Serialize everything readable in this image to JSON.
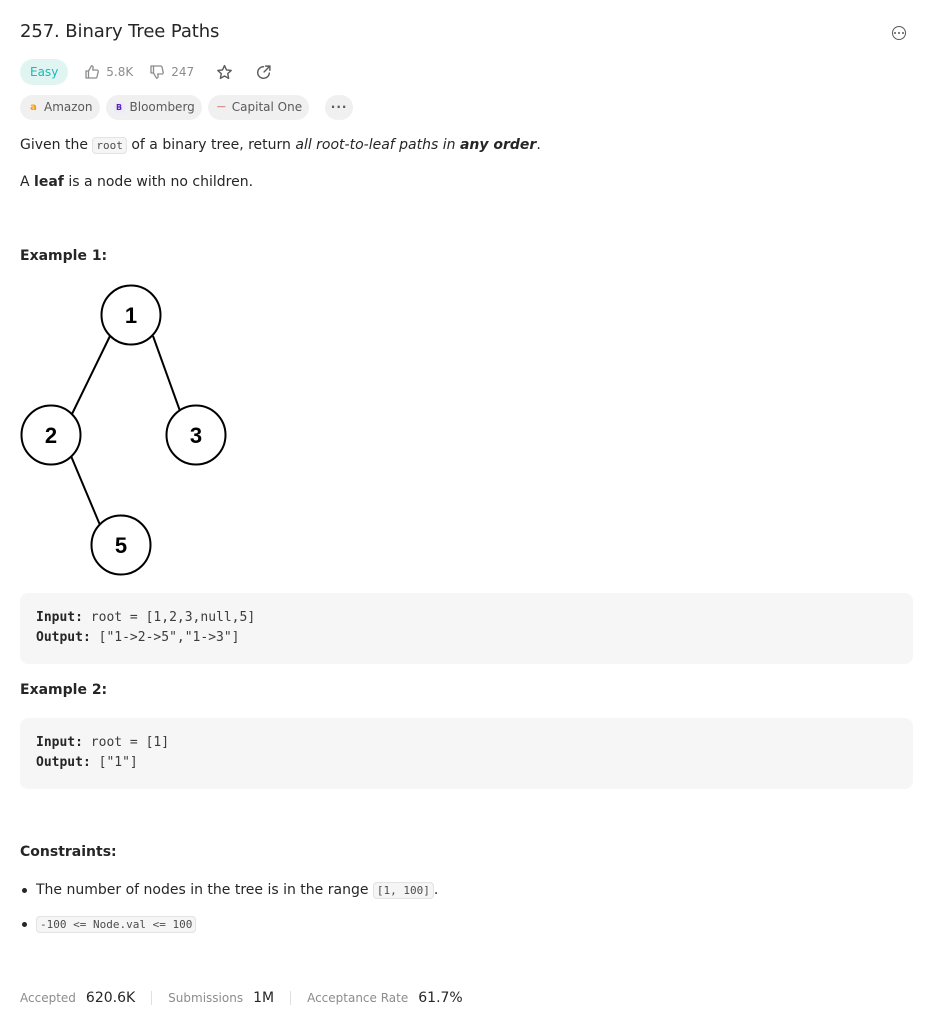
{
  "problem": {
    "title": "257. Binary Tree Paths",
    "difficulty": "Easy",
    "likes": "5.8K",
    "dislikes": "247"
  },
  "companies": [
    {
      "name": "Amazon",
      "logo": "a"
    },
    {
      "name": "Bloomberg",
      "logo": "B"
    },
    {
      "name": "Capital One",
      "logo": "—"
    }
  ],
  "more_tags": "···",
  "description": {
    "p1_pre": "Given the ",
    "p1_code": "root",
    "p1_mid": " of a binary tree, return ",
    "p1_italic": "all root-to-leaf paths in ",
    "p1_bold": "any order",
    "p1_end": ".",
    "p2_pre": "A ",
    "p2_bold": "leaf",
    "p2_end": " is a node with no children."
  },
  "example1": {
    "heading": "Example 1:",
    "tree_nodes": [
      "1",
      "2",
      "3",
      "5"
    ],
    "input_label": "Input:",
    "input_value": "root = [1,2,3,null,5]",
    "output_label": "Output:",
    "output_value": "[\"1->2->5\",\"1->3\"]"
  },
  "example2": {
    "heading": "Example 2:",
    "input_label": "Input:",
    "input_value": "root = [1]",
    "output_label": "Output:",
    "output_value": "[\"1\"]"
  },
  "constraints": {
    "heading": "Constraints:",
    "c1_text": "The number of nodes in the tree is in the range ",
    "c1_code": "[1, 100]",
    "c1_end": ".",
    "c2_code": "-100 <= Node.val <= 100"
  },
  "footer": {
    "accepted_label": "Accepted",
    "accepted_value": "620.6K",
    "submissions_label": "Submissions",
    "submissions_value": "1M",
    "rate_label": "Acceptance Rate",
    "rate_value": "61.7%"
  },
  "icons": [
    "more-options-icon",
    "thumbs-up-icon",
    "thumbs-down-icon",
    "star-icon",
    "share-icon"
  ],
  "colors": {
    "easy_bg": "#e0f5f1",
    "easy_text": "#1cb8b8",
    "code_bg": "#f6f6f6"
  }
}
